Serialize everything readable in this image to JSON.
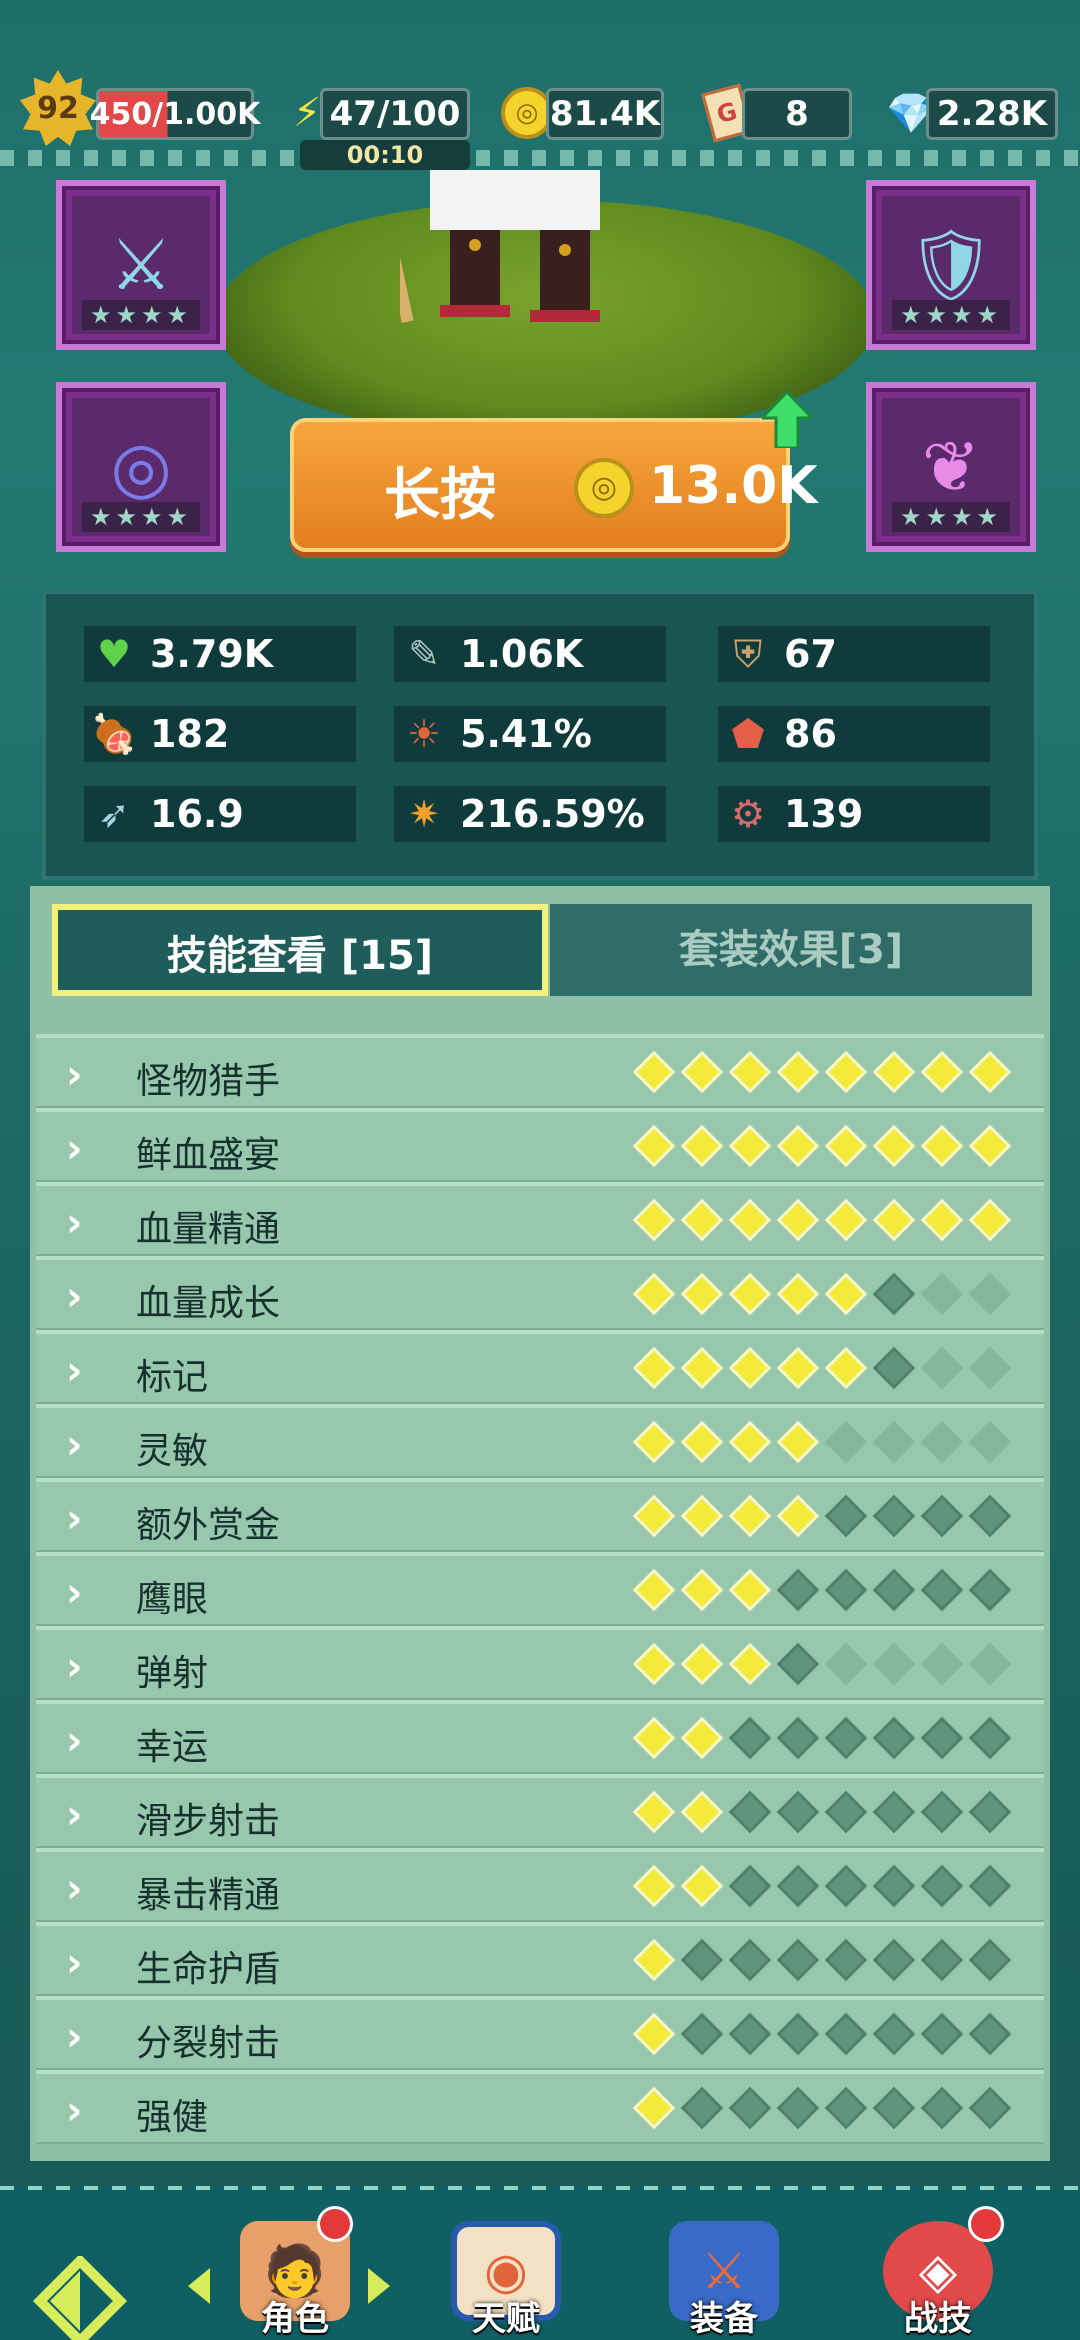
{
  "top": {
    "level": "92",
    "xp": "450/1.00K",
    "energy": "47/100",
    "timer": "00:10",
    "coins": "81.4K",
    "tickets": "8",
    "gems": "2.28K"
  },
  "equipment": {
    "slots": [
      {
        "name": "weapon",
        "icon": "⚔",
        "stars": "★★★★"
      },
      {
        "name": "armor",
        "icon": "🛡",
        "stars": "★★★★"
      },
      {
        "name": "ring",
        "icon": "💍",
        "stars": "★★★★"
      },
      {
        "name": "necklace",
        "icon": "📿",
        "stars": "★★★★"
      }
    ]
  },
  "press_button": {
    "label": "长按",
    "cost": "13.0K",
    "coin_glyph": "◎"
  },
  "stats": [
    {
      "icon": "♥",
      "value": "3.79K",
      "color": "#5fd14a"
    },
    {
      "icon": "✎",
      "value": "1.06K",
      "color": "#aac7c4"
    },
    {
      "icon": "⛨",
      "value": "67",
      "color": "#c9a16a"
    },
    {
      "icon": "🍖",
      "value": "182",
      "color": "#d86b6b"
    },
    {
      "icon": "☀",
      "value": "5.41%",
      "color": "#e2643a"
    },
    {
      "icon": "⬟",
      "value": "86",
      "color": "#e35f4a"
    },
    {
      "icon": "➶",
      "value": "16.9",
      "color": "#a8d4e4"
    },
    {
      "icon": "✷",
      "value": "216.59%",
      "color": "#f0a030"
    },
    {
      "icon": "⚙",
      "value": "139",
      "color": "#d86b6b"
    }
  ],
  "tabs": {
    "skills": "技能查看 [15]",
    "sets": "套装效果[3]"
  },
  "skills": [
    {
      "name": "怪物猎手",
      "pips": [
        1,
        1,
        1,
        1,
        1,
        1,
        1,
        1
      ]
    },
    {
      "name": "鲜血盛宴",
      "pips": [
        1,
        1,
        1,
        1,
        1,
        1,
        1,
        1
      ]
    },
    {
      "name": "血量精通",
      "pips": [
        1,
        1,
        1,
        1,
        1,
        1,
        1,
        1
      ]
    },
    {
      "name": "血量成长",
      "pips": [
        1,
        1,
        1,
        1,
        1,
        0,
        -1,
        -1
      ]
    },
    {
      "name": "标记",
      "pips": [
        1,
        1,
        1,
        1,
        1,
        0,
        -1,
        -1
      ]
    },
    {
      "name": "灵敏",
      "pips": [
        1,
        1,
        1,
        1,
        -1,
        -1,
        -1,
        -1
      ]
    },
    {
      "name": "额外赏金",
      "pips": [
        1,
        1,
        1,
        1,
        0,
        0,
        0,
        0
      ]
    },
    {
      "name": "鹰眼",
      "pips": [
        1,
        1,
        1,
        0,
        0,
        0,
        0,
        0
      ]
    },
    {
      "name": "弹射",
      "pips": [
        1,
        1,
        1,
        0,
        -1,
        -1,
        -1,
        -1
      ]
    },
    {
      "name": "幸运",
      "pips": [
        1,
        1,
        0,
        0,
        0,
        0,
        0,
        0
      ]
    },
    {
      "name": "滑步射击",
      "pips": [
        1,
        1,
        0,
        0,
        0,
        0,
        0,
        0
      ]
    },
    {
      "name": "暴击精通",
      "pips": [
        1,
        1,
        0,
        0,
        0,
        0,
        0,
        0
      ]
    },
    {
      "name": "生命护盾",
      "pips": [
        1,
        0,
        0,
        0,
        0,
        0,
        0,
        0
      ]
    },
    {
      "name": "分裂射击",
      "pips": [
        1,
        0,
        0,
        0,
        0,
        0,
        0,
        0
      ]
    },
    {
      "name": "强健",
      "pips": [
        1,
        0,
        0,
        0,
        0,
        0,
        0,
        0
      ]
    }
  ],
  "nav": {
    "hero": "角色",
    "talent": "天赋",
    "gear": "装备",
    "skill": "战技"
  },
  "colors": {
    "accent": "#f4ea3a",
    "orange": "#f0962c",
    "purple": "#7c2f8a"
  }
}
